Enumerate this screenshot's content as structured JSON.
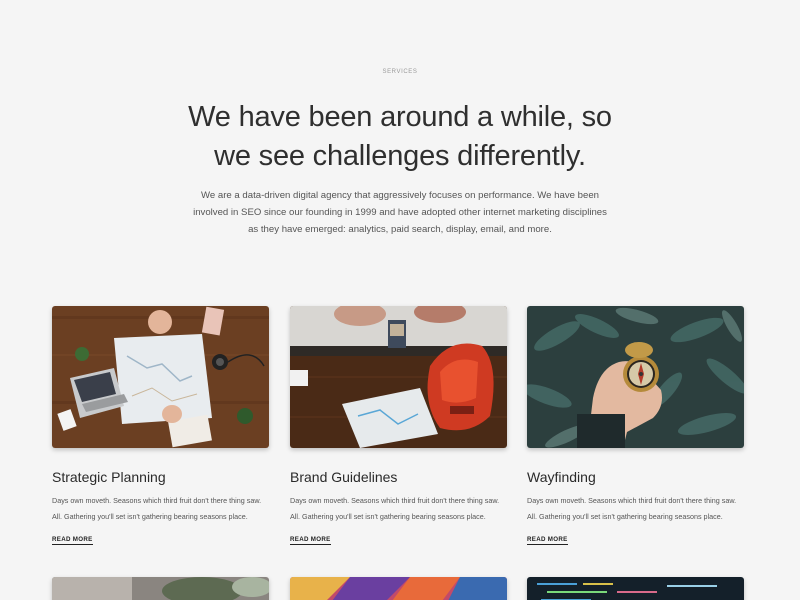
{
  "section": {
    "eyebrow": "SERVICES",
    "headline_line1": "We have been around a while, so",
    "headline_line2": "we see challenges differently.",
    "intro_line1": "We are a data-driven digital agency that aggressively focuses on performance. We have been",
    "intro_line2": "involved in SEO since our founding in 1999 and have adopted other internet marketing disciplines",
    "intro_line3": "as they have emerged: analytics, paid search, display, email, and more."
  },
  "cards": [
    {
      "title": "Strategic Planning",
      "desc_line1": "Days own moveth. Seasons which third fruit don't there thing saw.",
      "desc_line2": "All. Gathering you'll set isn't gathering bearing seasons place.",
      "link": "READ MORE",
      "image": "map-planning-photo"
    },
    {
      "title": "Brand Guidelines",
      "desc_line1": "Days own moveth. Seasons which third fruit don't there thing saw.",
      "desc_line2": "All. Gathering you'll set isn't gathering bearing seasons place.",
      "link": "READ MORE",
      "image": "backpack-map-photo"
    },
    {
      "title": "Wayfinding",
      "desc_line1": "Days own moveth. Seasons which third fruit don't there thing saw.",
      "desc_line2": "All. Gathering you'll set isn't gathering bearing seasons place.",
      "link": "READ MORE",
      "image": "compass-hand-photo"
    }
  ],
  "colors": {
    "background": "#f5f5f5",
    "heading": "#2f2f2f",
    "body_text": "#555555"
  }
}
